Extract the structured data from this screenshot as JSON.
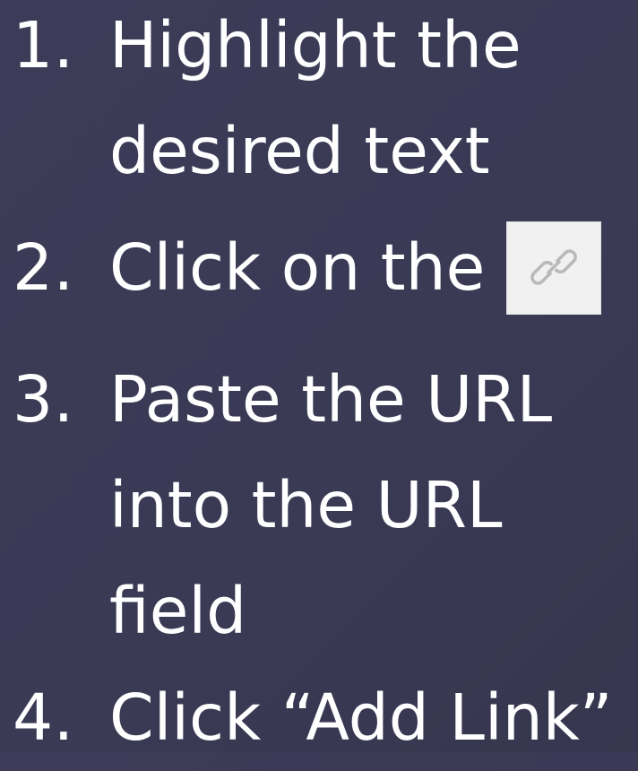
{
  "steps": [
    {
      "number": "1.",
      "lines": [
        "Highlight the",
        "desired text"
      ]
    },
    {
      "number": "2.",
      "lines": [
        "Click on the"
      ],
      "icon": "link-icon"
    },
    {
      "number": "3.",
      "lines": [
        "Paste the URL",
        "into the URL",
        "field"
      ]
    },
    {
      "number": "4.",
      "lines": [
        "Click “Add Link”"
      ]
    }
  ],
  "colors": {
    "background": "#3a3a55",
    "text": "#ffffff",
    "icon_box": "#f1f1f1"
  }
}
